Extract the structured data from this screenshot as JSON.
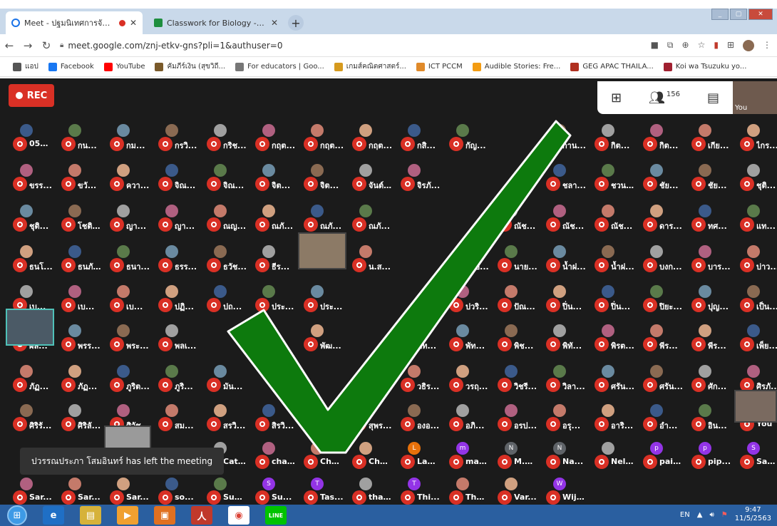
{
  "browser": {
    "tabs": [
      {
        "title": "Meet - ปฐมนิเทศการจัดการเรียน",
        "active": true,
        "icon": "meet-icon",
        "recording_indicator": true
      },
      {
        "title": "Classwork for Biology - 63 ม.4",
        "active": false,
        "icon": "classroom-icon"
      }
    ],
    "new_tab_label": "+",
    "url": "meet.google.com/znj-etkv-gns?pli=1&authuser=0",
    "bookmarks": [
      {
        "label": "แอป",
        "icon": "apps-grid-icon",
        "color": "#555555"
      },
      {
        "label": "Facebook",
        "icon": "facebook-icon",
        "color": "#1877f2"
      },
      {
        "label": "YouTube",
        "icon": "youtube-icon",
        "color": "#ff0000"
      },
      {
        "label": "คัมภีร์เงิน (สุขวิถี...",
        "icon": "bookmark-icon",
        "color": "#7a5a2a"
      },
      {
        "label": "For educators | Goo...",
        "icon": "bookmark-icon",
        "color": "#777777"
      },
      {
        "label": "เกมส์คณิตศาสตร์...",
        "icon": "bookmark-icon",
        "color": "#d69a1e"
      },
      {
        "label": "ICT PCCM",
        "icon": "bookmark-icon",
        "color": "#e08a2a"
      },
      {
        "label": "Audible Stories: Fre...",
        "icon": "audible-icon",
        "color": "#f39c12"
      },
      {
        "label": "GEG APAC THAILA...",
        "icon": "bookmark-icon",
        "color": "#b03020"
      },
      {
        "label": "Koi wa Tsuzuku yo...",
        "icon": "bookmark-icon",
        "color": "#a02030"
      }
    ]
  },
  "meet": {
    "rec_label": "REC",
    "participant_count": "156",
    "self_label": "You",
    "toast_message": "ปวรรณประภา โสมอินทร์ has left the meeting",
    "rows": [
      [
        "054...",
        "กน...",
        "กม...",
        "กรวิ...",
        "กริช...",
        "กฤต...",
        "กฤต...",
        "กฤต...",
        "กสิ...",
        "กัญ...",
        "",
        "กาน...",
        "กิต...",
        "กิต...",
        "เกีย...",
        "ไกร..."
      ],
      [
        "ขรร...",
        "ขวั...",
        "ควา...",
        "จิณ...",
        "จิณ...",
        "จิต...",
        "จิต...",
        "จันต์...",
        "จิรภั...",
        "",
        "",
        "ชลา...",
        "ชวน...",
        "ชัย...",
        "ชัย...",
        "ชุติ..."
      ],
      [
        "ชุติ...",
        "โชติ...",
        "ญา...",
        "ญา...",
        "ณญ...",
        "ณภั...",
        "ณภั...",
        "ณภั...",
        "",
        "",
        "ณัช...",
        "ณัช...",
        "ณัช...",
        "ดาร...",
        "ทศ...",
        "แท..."
      ],
      [
        "ธนโ...",
        "ธนภั...",
        "ธนา...",
        "ธรร...",
        "ธวัช...",
        "ธีร...",
        "",
        "น.ส...",
        "",
        "นาย...",
        "นาย...",
        "น้ำฝ...",
        "น้ำฝ...",
        "บงก...",
        "บาร...",
        "บ่าว..."
      ],
      [
        "เบ...",
        "เบ...",
        "เบ...",
        "ปฏิ...",
        "ปถ...",
        "ประ...",
        "ประ...",
        "",
        "",
        "ปวริ...",
        "ปัณ...",
        "ปิ่น...",
        "ปิ่น...",
        "ปิยะ...",
        "ปุญ...",
        "เป็น..."
      ],
      [
        "ผล...",
        "พรร...",
        "พระ...",
        "พลเ...",
        "",
        "",
        "พัฒ...",
        "",
        "พัท...",
        "พัท...",
        "พิช...",
        "พิทั...",
        "พิรต...",
        "พีร...",
        "พีร...",
        "เพ็ย..."
      ],
      [
        "ภัฏ...",
        "ภัฏ...",
        "ภูริต...",
        "ภูริ...",
        "มัน...",
        "",
        "",
        "",
        "วธิร...",
        "วรฤ...",
        "วิชรี...",
        "วิลา...",
        "ศรัน...",
        "ศรัน...",
        "ศัก...",
        "ศิรภั..."
      ],
      [
        "ศิริรั...",
        "ศิริลั...",
        "ศิวัช...",
        "สม...",
        "สรวิ...",
        "สิรวิ...",
        "",
        "สุพร...",
        "องอ...",
        "อภิ...",
        "อรป...",
        "อรุ...",
        "อาริ...",
        "อำ...",
        "อิน...",
        "You"
      ],
      [
        "",
        "",
        "",
        "",
        "Cat...",
        "cha...",
        "Cha...",
        "Cho...",
        "Lad...",
        "mat...",
        "M.O...",
        "Na...",
        "Nell...",
        "pait...",
        "pip...",
        "San..."
      ],
      [
        "Sar...",
        "Sar...",
        "Sar...",
        "so...",
        "Sup...",
        "Su...",
        "Tas...",
        "tha...",
        "Thi...",
        "Thu...",
        "Var...",
        "Wiji...",
        "",
        "",
        "",
        ""
      ]
    ],
    "letter_avatars": {
      "8-8": "L",
      "8-9": "m",
      "8-10": "N",
      "8-11": "N",
      "8-13": "p",
      "8-14": "p",
      "8-15": "S",
      "9-5": "S",
      "9-6": "T",
      "9-8": "T",
      "9-11": "W"
    },
    "colors": {
      "mic_off": "#d93025",
      "background": "#1b1b1b",
      "checkmark": "#0d7a0d",
      "checkmark_outline": "#ffffff"
    }
  },
  "taskbar": {
    "apps": [
      {
        "icon": "internet-explorer-icon",
        "label": "e"
      },
      {
        "icon": "file-explorer-icon",
        "label": "▤"
      },
      {
        "icon": "media-player-icon",
        "label": "▶"
      },
      {
        "icon": "video-icon",
        "label": "▣"
      },
      {
        "icon": "acrobat-icon",
        "label": "人"
      },
      {
        "icon": "chrome-icon",
        "label": "◉"
      },
      {
        "icon": "line-icon",
        "label": "LINE"
      }
    ],
    "language": "EN",
    "time": "9:47",
    "date": "11/5/2563"
  }
}
